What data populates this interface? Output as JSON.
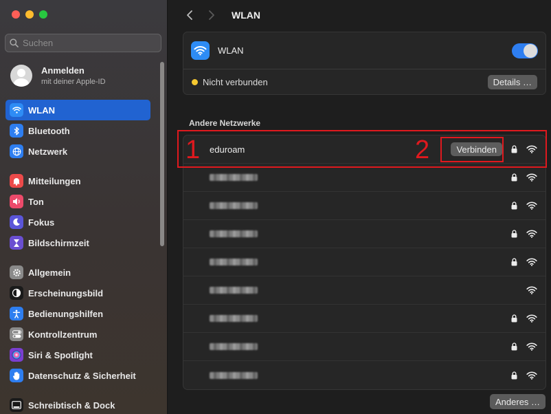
{
  "sidebar": {
    "search_placeholder": "Suchen",
    "account": {
      "title": "Anmelden",
      "subtitle": "mit deiner Apple-ID"
    },
    "groups": [
      [
        {
          "label": "WLAN",
          "icon": "wifi-icon",
          "color": "#2e8cf5",
          "active": true
        },
        {
          "label": "Bluetooth",
          "icon": "bluetooth-icon",
          "color": "#2e7ef0"
        },
        {
          "label": "Netzwerk",
          "icon": "globe-icon",
          "color": "#2e7ef0"
        }
      ],
      [
        {
          "label": "Mitteilungen",
          "icon": "bell-icon",
          "color": "#ec4a4a"
        },
        {
          "label": "Ton",
          "icon": "speaker-icon",
          "color": "#ec4a6a"
        },
        {
          "label": "Fokus",
          "icon": "moon-icon",
          "color": "#5b55d8"
        },
        {
          "label": "Bildschirmzeit",
          "icon": "hourglass-icon",
          "color": "#6a4fd1"
        }
      ],
      [
        {
          "label": "Allgemein",
          "icon": "gear-icon",
          "color": "#8a8a8a"
        },
        {
          "label": "Erscheinungsbild",
          "icon": "appearance-icon",
          "color": "#1a1a1a"
        },
        {
          "label": "Bedienungshilfen",
          "icon": "accessibility-icon",
          "color": "#2e7ef0"
        },
        {
          "label": "Kontrollzentrum",
          "icon": "toggles-icon",
          "color": "#8a8a8a"
        },
        {
          "label": "Siri & Spotlight",
          "icon": "siri-icon",
          "color": "#7a3fd0"
        },
        {
          "label": "Datenschutz & Sicherheit",
          "icon": "hand-icon",
          "color": "#2e7ef0"
        }
      ],
      [
        {
          "label": "Schreibtisch & Dock",
          "icon": "dock-icon",
          "color": "#1a1a1a"
        }
      ]
    ]
  },
  "main": {
    "title": "WLAN",
    "wifi": {
      "label": "WLAN",
      "enabled": true,
      "status": "Nicht verbunden",
      "details_button": "Details …"
    },
    "other_networks_label": "Andere Netzwerke",
    "networks": [
      {
        "name": "eduroam",
        "obscured": false,
        "secured": true,
        "connect_button": "Verbinden"
      },
      {
        "name": "",
        "obscured": true,
        "secured": true
      },
      {
        "name": "",
        "obscured": true,
        "secured": true
      },
      {
        "name": "",
        "obscured": true,
        "secured": true
      },
      {
        "name": "",
        "obscured": true,
        "secured": true
      },
      {
        "name": "",
        "obscured": true,
        "secured": false
      },
      {
        "name": "",
        "obscured": true,
        "secured": true
      },
      {
        "name": "",
        "obscured": true,
        "secured": true
      },
      {
        "name": "",
        "obscured": true,
        "secured": true
      }
    ],
    "others_button": "Anderes …"
  },
  "annotations": [
    "1",
    "2"
  ],
  "colors": {
    "accent": "#2163d1",
    "annotation": "#e0191e",
    "status_dot": "#f5c830"
  }
}
